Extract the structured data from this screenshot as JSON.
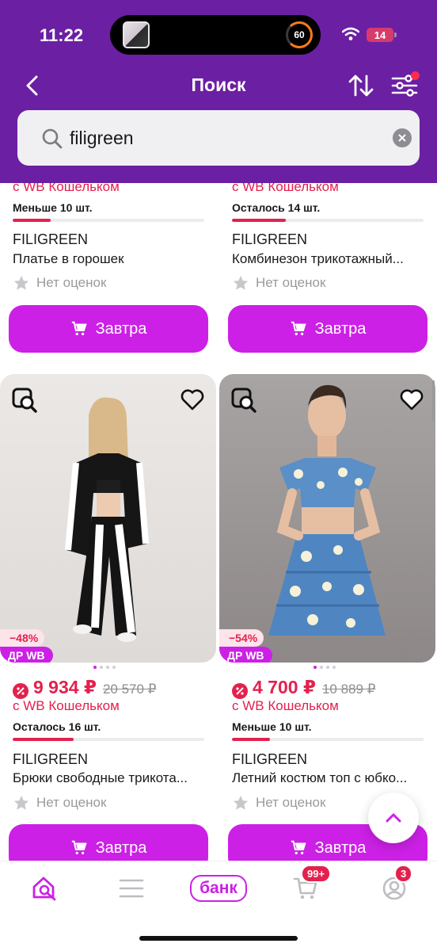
{
  "status_bar": {
    "time": "11:22",
    "activity_value": "60",
    "battery": "14"
  },
  "header": {
    "title": "Поиск"
  },
  "search": {
    "value": "filigreen"
  },
  "products": [
    {
      "wallet": "с WB Кошельком",
      "stock": "Меньше 10 шт.",
      "stock_level": 0.2,
      "brand": "FILIGREEN",
      "title": "Платье в горошек",
      "rating": "Нет оценок",
      "cart": "Завтра"
    },
    {
      "wallet": "с WB Кошельком",
      "stock": "Осталось 14 шт.",
      "stock_level": 0.28,
      "brand": "FILIGREEN",
      "title": "Комбинезон трикотажный...",
      "rating": "Нет оценок",
      "cart": "Завтра"
    },
    {
      "discount": "−48%",
      "badge": "ДР WB",
      "price": "9 934 ₽",
      "old_price": "20 570 ₽",
      "wallet": "с WB Кошельком",
      "stock": "Осталось 16 шт.",
      "stock_level": 0.32,
      "brand": "FILIGREEN",
      "title": "Брюки свободные трикота...",
      "rating": "Нет оценок",
      "cart": "Завтра"
    },
    {
      "discount": "−54%",
      "badge": "ДР WB",
      "price": "4 700 ₽",
      "old_price": "10 889 ₽",
      "wallet": "с WB Кошельком",
      "stock": "Меньше 10 шт.",
      "stock_level": 0.2,
      "brand": "FILIGREEN",
      "title": "Летний костюм топ с юбко...",
      "rating": "Нет оценок",
      "cart": "Завтра"
    }
  ],
  "bottom_nav": {
    "bank_label": "банк",
    "cart_badge": "99+",
    "profile_badge": "3"
  },
  "colors": {
    "header": "#6b1fa3",
    "accent": "#cc20e6",
    "price": "#e3214e"
  },
  "icons": [
    "back-icon",
    "sort-icon",
    "filter-icon",
    "search-icon",
    "clear-icon",
    "similar-icon",
    "heart-icon",
    "star-icon",
    "cart-icon",
    "home-icon",
    "catalog-icon",
    "profile-icon",
    "chevron-up-icon"
  ]
}
